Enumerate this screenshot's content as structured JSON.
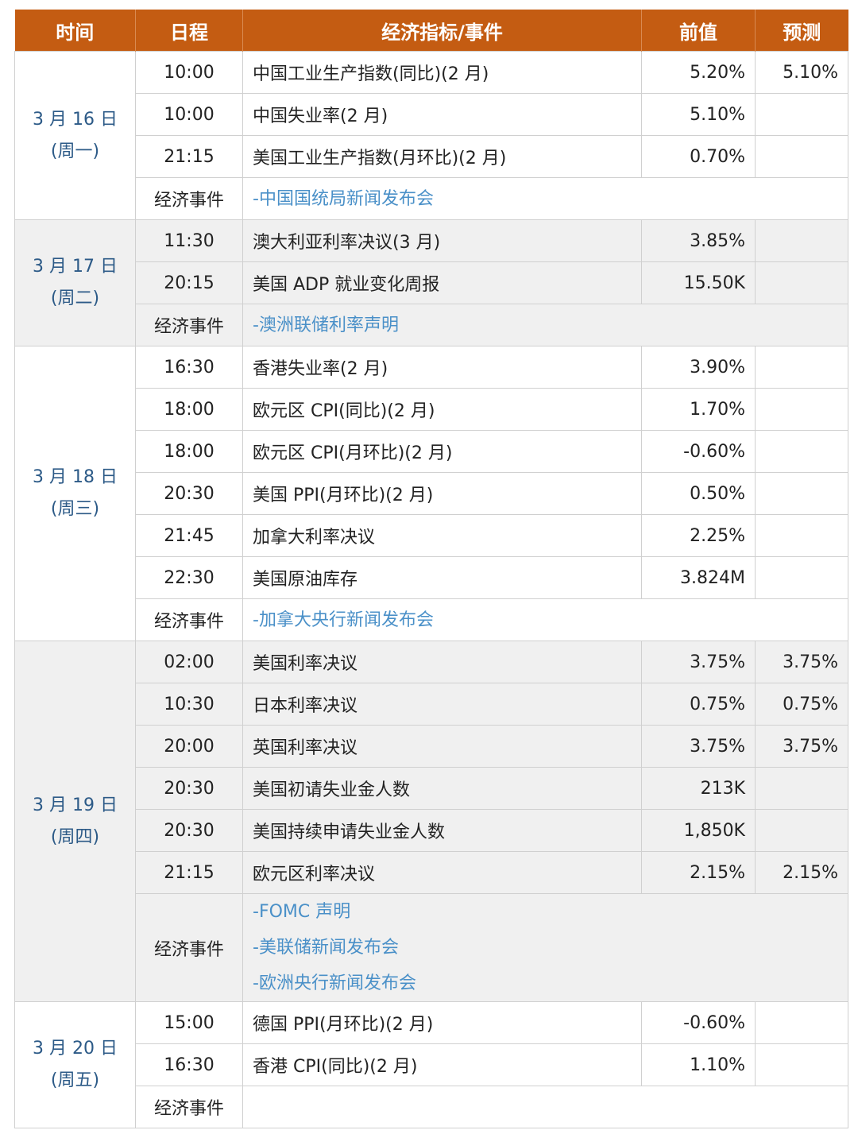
{
  "headers": [
    "时间",
    "日程",
    "经济指标/事件",
    "前值",
    "预测"
  ],
  "event_label": "经济事件",
  "days": [
    {
      "date": "3 月 16 日",
      "weekday": "(周一)",
      "rows": [
        {
          "time": "10:00",
          "indicator": "中国工业生产指数(同比)(2 月)",
          "prev": "5.20%",
          "forecast": "5.10%"
        },
        {
          "time": "10:00",
          "indicator": "中国失业率(2 月)",
          "prev": "5.10%",
          "forecast": ""
        },
        {
          "time": "21:15",
          "indicator": "美国工业生产指数(月环比)(2 月)",
          "prev": "0.70%",
          "forecast": ""
        }
      ],
      "events": [
        "-中国国统局新闻发布会"
      ]
    },
    {
      "date": "3 月 17 日",
      "weekday": "(周二)",
      "rows": [
        {
          "time": "11:30",
          "indicator": "澳大利亚利率决议(3 月)",
          "prev": "3.85%",
          "forecast": ""
        },
        {
          "time": "20:15",
          "indicator": "美国 ADP 就业变化周报",
          "prev": "15.50K",
          "forecast": ""
        }
      ],
      "events": [
        "-澳洲联储利率声明"
      ]
    },
    {
      "date": "3 月 18 日",
      "weekday": "(周三)",
      "rows": [
        {
          "time": "16:30",
          "indicator": "香港失业率(2 月)",
          "prev": "3.90%",
          "forecast": ""
        },
        {
          "time": "18:00",
          "indicator": "欧元区 CPI(同比)(2 月)",
          "prev": "1.70%",
          "forecast": ""
        },
        {
          "time": "18:00",
          "indicator": "欧元区 CPI(月环比)(2 月)",
          "prev": "-0.60%",
          "forecast": ""
        },
        {
          "time": "20:30",
          "indicator": "美国 PPI(月环比)(2 月)",
          "prev": "0.50%",
          "forecast": ""
        },
        {
          "time": "21:45",
          "indicator": "加拿大利率决议",
          "prev": "2.25%",
          "forecast": ""
        },
        {
          "time": "22:30",
          "indicator": "美国原油库存",
          "prev": "3.824M",
          "forecast": ""
        }
      ],
      "events": [
        "-加拿大央行新闻发布会"
      ]
    },
    {
      "date": "3 月 19 日",
      "weekday": "(周四)",
      "rows": [
        {
          "time": "02:00",
          "indicator": "美国利率决议",
          "prev": "3.75%",
          "forecast": "3.75%"
        },
        {
          "time": "10:30",
          "indicator": "日本利率决议",
          "prev": "0.75%",
          "forecast": "0.75%"
        },
        {
          "time": "20:00",
          "indicator": "英国利率决议",
          "prev": "3.75%",
          "forecast": "3.75%"
        },
        {
          "time": "20:30",
          "indicator": "美国初请失业金人数",
          "prev": "213K",
          "forecast": ""
        },
        {
          "time": "20:30",
          "indicator": "美国持续申请失业金人数",
          "prev": "1,850K",
          "forecast": ""
        },
        {
          "time": "21:15",
          "indicator": "欧元区利率决议",
          "prev": "2.15%",
          "forecast": "2.15%"
        }
      ],
      "events": [
        "-FOMC 声明",
        "-美联储新闻发布会",
        "-欧洲央行新闻发布会"
      ]
    },
    {
      "date": "3 月 20 日",
      "weekday": "(周五)",
      "rows": [
        {
          "time": "15:00",
          "indicator": "德国 PPI(月环比)(2 月)",
          "prev": "-0.60%",
          "forecast": ""
        },
        {
          "time": "16:30",
          "indicator": "香港 CPI(同比)(2 月)",
          "prev": "1.10%",
          "forecast": ""
        }
      ],
      "events": []
    }
  ]
}
